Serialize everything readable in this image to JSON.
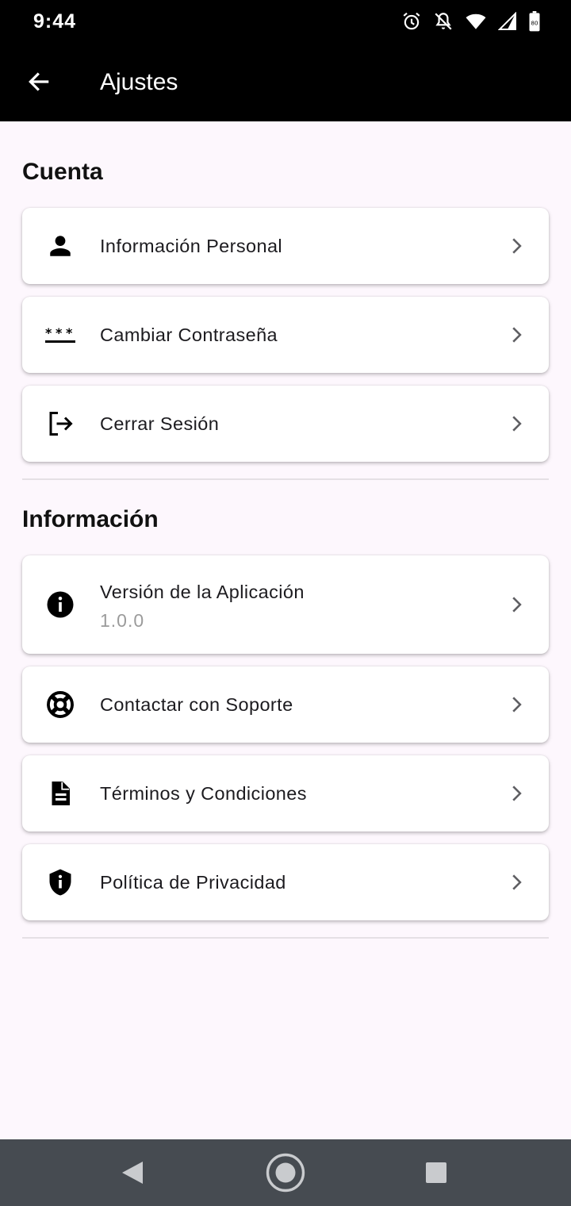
{
  "status_bar": {
    "time": "9:44",
    "icons": [
      "alarm-icon",
      "notifications-off-icon",
      "wifi-icon",
      "signal-icon",
      "battery-icon"
    ]
  },
  "app_bar": {
    "title": "Ajustes",
    "back_icon": "arrow-back-icon"
  },
  "sections": [
    {
      "title": "Cuenta",
      "items": [
        {
          "label": "Información Personal",
          "icon": "person-icon"
        },
        {
          "label": "Cambiar Contraseña",
          "icon": "password-icon"
        },
        {
          "label": "Cerrar Sesión",
          "icon": "logout-icon"
        }
      ]
    },
    {
      "title": "Información",
      "items": [
        {
          "label": "Versión de la Aplicación",
          "sublabel": "1.0.0",
          "icon": "info-icon"
        },
        {
          "label": "Contactar con Soporte",
          "icon": "support-icon"
        },
        {
          "label": "Términos y Condiciones",
          "icon": "description-icon"
        },
        {
          "label": "Política de Privacidad",
          "icon": "privacy-shield-icon"
        }
      ]
    }
  ],
  "nav_bar": {
    "buttons": [
      "nav-back-icon",
      "nav-home-icon",
      "nav-recents-icon"
    ]
  },
  "colors": {
    "app_bar": "#000000",
    "background": "#fdf7fd",
    "card": "#ffffff",
    "sublabel": "#9b9b9b",
    "nav_bar": "#464b51"
  }
}
